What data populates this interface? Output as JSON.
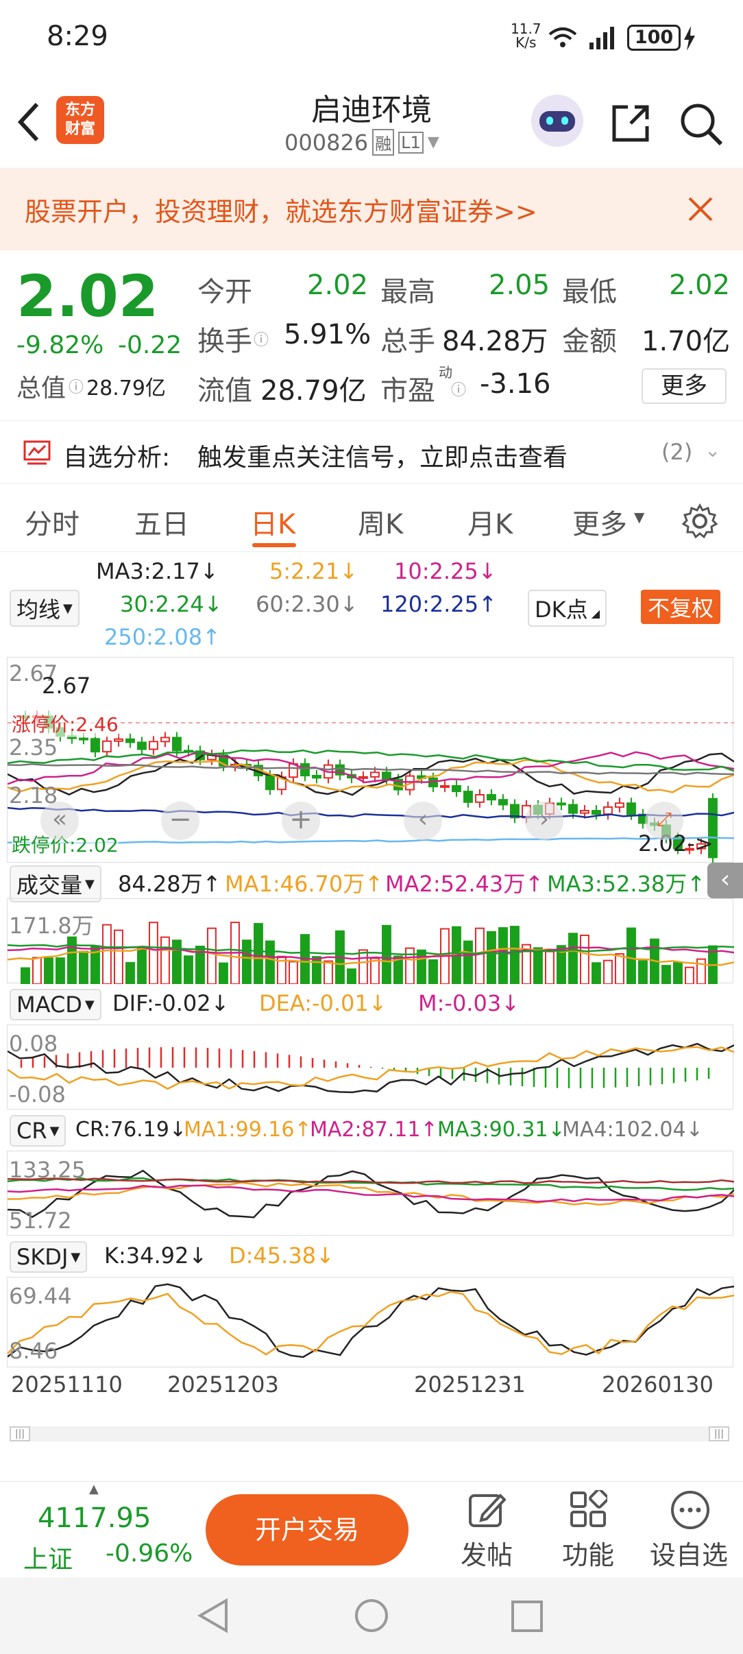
{
  "status_bar": {
    "time": "8:29",
    "net_speed_top": "11.7",
    "net_speed_bottom": "K/s",
    "battery": "100"
  },
  "header": {
    "title": "启迪环境",
    "code": "000826",
    "tag_rong": "融",
    "tag_level": "L1",
    "logo_text_1": "东方",
    "logo_text_2": "财富"
  },
  "banner": {
    "text": "股票开户，投资理财，就选东方财富证券>>"
  },
  "quote": {
    "price": "2.02",
    "change_pct": "-9.82%",
    "change_amt": "-0.22",
    "total_value_label": "总值",
    "total_value": "28.79亿",
    "open_label": "今开",
    "open": "2.02",
    "high_label": "最高",
    "high": "2.05",
    "low_label": "最低",
    "low": "2.02",
    "turnover_label": "换手",
    "turnover": "5.91%",
    "volume_label": "总手",
    "volume": "84.28万",
    "amount_label": "金额",
    "amount": "1.70亿",
    "float_label": "流值",
    "float_value": "28.79亿",
    "pe_label": "市盈",
    "pe_sup": "动",
    "pe": "-3.16",
    "more_button": "更多"
  },
  "analysis": {
    "label": "自选分析:",
    "text": "触发重点关注信号，立即点击查看",
    "count": "(2)"
  },
  "tabs": [
    "分时",
    "五日",
    "日K",
    "周K",
    "月K",
    "更多"
  ],
  "active_tab": "日K",
  "ma": {
    "selector": "均线",
    "ma3": "MA3:2.17↓",
    "ma5": "5:2.21↓",
    "ma10": "10:2.25↓",
    "ma30": "30:2.24↓",
    "ma60": "60:2.30↓",
    "ma120": "120:2.25↑",
    "ma250": "250:2.08↑",
    "dk_button": "DK点",
    "fq_button": "不复权"
  },
  "kline": {
    "high_label": "2.67",
    "high_marker": "2.67",
    "limit_up_label": "涨停价:2.46",
    "y2": "2.35",
    "y3": "2.18",
    "limit_down_label": "跌停价:2.02",
    "last_marker": "2.02->"
  },
  "volume": {
    "selector": "成交量",
    "value": "84.28万↑",
    "ma1": "MA1:46.70万↑",
    "ma2": "MA2:52.43万↑",
    "ma3": "MA3:52.38万↑",
    "max_label": "171.8万"
  },
  "macd": {
    "selector": "MACD",
    "dif": "DIF:-0.02↓",
    "dea": "DEA:-0.01↓",
    "m": "M:-0.03↓",
    "top": "0.08",
    "bottom": "-0.08"
  },
  "cr": {
    "selector": "CR",
    "cr": "CR:76.19↓",
    "ma1": "MA1:99.16↑",
    "ma2": "MA2:87.11↑",
    "ma3": "MA3:90.31↓",
    "ma4": "MA4:102.04↓",
    "top": "133.25",
    "bottom": "51.72"
  },
  "skdj": {
    "selector": "SKDJ",
    "k": "K:34.92↓",
    "d": "D:45.38↓",
    "top": "69.44",
    "bottom": "8.46"
  },
  "dates": [
    "20251110",
    "20251203",
    "20251231",
    "20260130"
  ],
  "footer": {
    "index_value": "4117.95",
    "index_name": "上证",
    "index_change": "-0.96%",
    "trade_button": "开户交易",
    "post": "发帖",
    "func": "功能",
    "watch": "设自选"
  },
  "colors": {
    "up": "#e12a2a",
    "down": "#1aa01a",
    "accent": "#f0601e",
    "ma3": "#222222",
    "ma5": "#f0a020",
    "ma10": "#d0208a",
    "ma30": "#1a9a2a",
    "ma60": "#777777",
    "ma120": "#1a2e9a",
    "ma250": "#66b8f0"
  }
}
